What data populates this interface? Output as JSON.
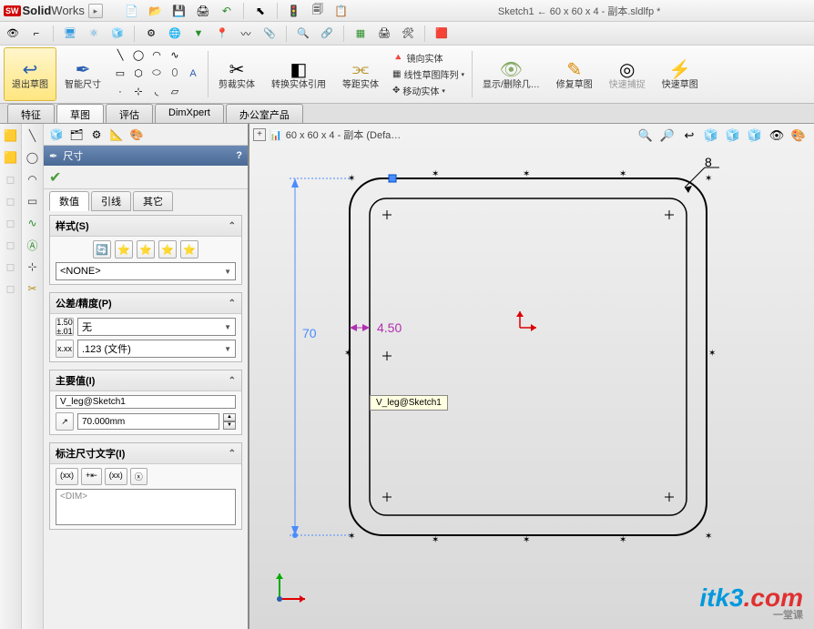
{
  "app": {
    "name1": "Solid",
    "name2": "Works",
    "logo": "SW"
  },
  "title": "Sketch1 ← 60 x 60 x 4 - 副本.sldlfp *",
  "ribbon": {
    "exit_sketch": "退出草图",
    "smart_dim": "智能尺寸",
    "trim": "剪裁实体",
    "convert": "转换实体引用",
    "offset": "等距实体",
    "col": {
      "mirror": "镜向实体",
      "linear": "线性草图阵列",
      "move": "移动实体"
    },
    "show_hide": "显示/删除几…",
    "repair": "修复草图",
    "quick_snap": "快速捕捉",
    "rapid_sketch": "快速草图"
  },
  "tabs": [
    "特征",
    "草图",
    "评估",
    "DimXpert",
    "办公室产品"
  ],
  "active_tab": 1,
  "breadcrumb": "60 x 60 x 4 - 副本  (Defa…",
  "property": {
    "title": "尺寸",
    "sub_tabs": [
      "数值",
      "引线",
      "其它"
    ],
    "style": {
      "head": "样式(S)",
      "combo": "<NONE>"
    },
    "tol": {
      "head": "公差/精度(P)",
      "mode": "无",
      "precision": ".123 (文件)"
    },
    "primary": {
      "head": "主要值(I)",
      "name": "V_leg@Sketch1",
      "value": "70.000mm"
    },
    "dimtext": {
      "head": "标注尺寸文字(I)",
      "hint": "<DIM>"
    }
  },
  "dims": {
    "v": "70",
    "offset": "4.50",
    "radius": "8"
  },
  "tooltip": "V_leg@Sketch1",
  "watermark": {
    "text": "itk3",
    "suffix": ".com",
    "sub": "一堂课"
  }
}
